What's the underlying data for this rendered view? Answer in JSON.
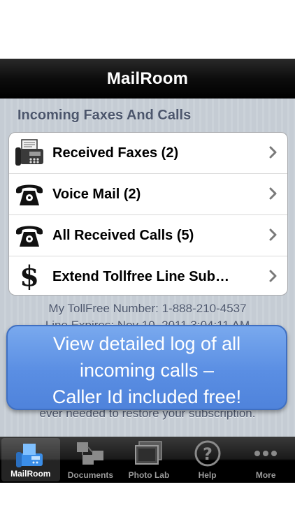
{
  "navbar": {
    "title": "MailRoom"
  },
  "section": {
    "header": "Incoming Faxes And Calls"
  },
  "rows": [
    {
      "label": "Received Faxes (2)",
      "icon": "fax-icon"
    },
    {
      "label": "Voice Mail (2)",
      "icon": "phone-icon"
    },
    {
      "label": "All Received Calls (5)",
      "icon": "phone-icon"
    },
    {
      "label": "Extend Tollfree Line Sub…",
      "icon": "dollar-icon"
    }
  ],
  "footer": {
    "number": "My TollFree Number: 1-888-210-4537",
    "expires": "Line Expires: Nov 10, 2011 3:04:11 AM",
    "note": "ever needed to restore your subscription."
  },
  "overlay": {
    "line1": "View detailed log of all",
    "line2": "incoming calls –",
    "line3": "Caller Id included free!"
  },
  "tabs": [
    {
      "label": "MailRoom",
      "active": true
    },
    {
      "label": "Documents"
    },
    {
      "label": "Photo Lab"
    },
    {
      "label": "Help"
    },
    {
      "label": "More"
    }
  ],
  "colors": {
    "accent": "#5a8ee3",
    "section_text": "#4c566c"
  }
}
